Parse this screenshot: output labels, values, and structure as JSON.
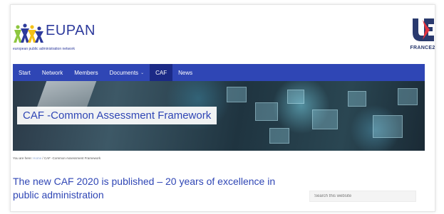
{
  "header": {
    "logo_text": "EUPAN",
    "logo_tagline": "european public administration network",
    "partner_logo_text": "FRANCE2"
  },
  "nav": {
    "items": [
      {
        "label": "Start"
      },
      {
        "label": "Network"
      },
      {
        "label": "Members"
      },
      {
        "label": "Documents",
        "has_dropdown": true
      },
      {
        "label": "CAF",
        "active": true
      },
      {
        "label": "News"
      }
    ]
  },
  "banner": {
    "title": "CAF -Common Assessment Framework"
  },
  "breadcrumb": {
    "prefix": "You are here:",
    "home": "Home",
    "separator": " / ",
    "current": "CAF -Common Assessment Framework"
  },
  "article": {
    "headline": "The new CAF 2020 is published – 20 years of excellence in public administration"
  },
  "search": {
    "placeholder": "Search this website"
  },
  "colors": {
    "nav_bg": "#2f46b5",
    "nav_active_bg": "#1b2a86",
    "headline": "#2f46b5",
    "logo_blue": "#2d3a9c",
    "logo_green": "#8dc63f",
    "logo_yellow": "#f3c117",
    "partner_red": "#e2333f",
    "partner_blue": "#2a3a6e"
  },
  "icons": {
    "logo_mark": "eupan-people-icon",
    "partner_mark": "france-ue-logo-icon",
    "dropdown": "chevron-down-icon"
  }
}
